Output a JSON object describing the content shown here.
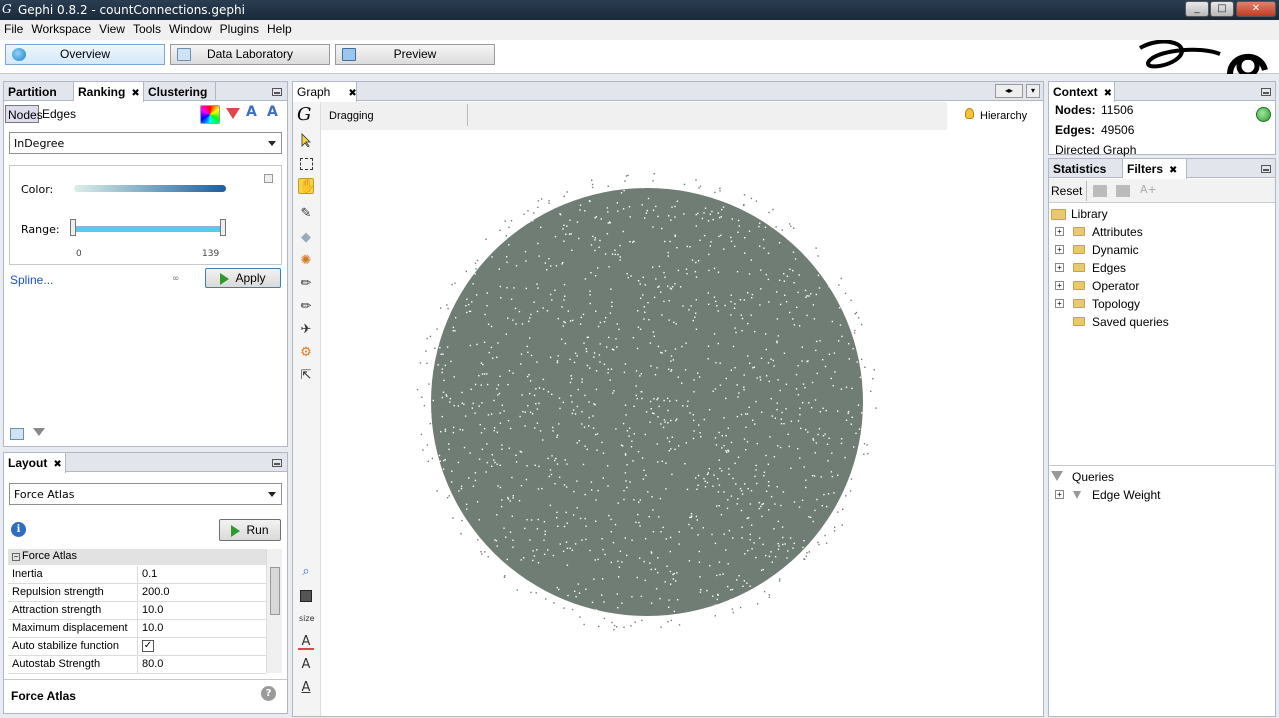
{
  "window": {
    "title": "Gephi 0.8.2 - countConnections.gephi",
    "controls": [
      "_",
      "□",
      "✕"
    ]
  },
  "menu": [
    "File",
    "Workspace",
    "View",
    "Tools",
    "Window",
    "Plugins",
    "Help"
  ],
  "toolbar": {
    "overview": "Overview",
    "data_lab": "Data Laboratory",
    "preview": "Preview"
  },
  "left_top": {
    "tabs": [
      "Partition",
      "Ranking",
      "Clustering"
    ],
    "subtabs": [
      "Nodes",
      "Edges"
    ],
    "ranking_param": "InDegree",
    "color_label": "Color:",
    "range_label": "Range:",
    "range_min": "0",
    "range_max": "139",
    "spline_link": "Spline...",
    "apply_button": "Apply"
  },
  "layout": {
    "title": "Layout",
    "algorithm": "Force Atlas",
    "run_button": "Run",
    "section": "Force Atlas",
    "properties": [
      {
        "name": "Inertia",
        "value": "0.1"
      },
      {
        "name": "Repulsion strength",
        "value": "200.0"
      },
      {
        "name": "Attraction strength",
        "value": "10.0"
      },
      {
        "name": "Maximum displacement",
        "value": "10.0"
      },
      {
        "name": "Auto stabilize function",
        "value": "✓"
      },
      {
        "name": "Autostab Strength",
        "value": "80.0"
      }
    ],
    "footer": "Force Atlas"
  },
  "graph": {
    "tab": "Graph",
    "mode": "Dragging",
    "hierarchy": "Hierarchy",
    "size_label": "size"
  },
  "context": {
    "title": "Context",
    "nodes_label": "Nodes:",
    "nodes": "11506",
    "edges_label": "Edges:",
    "edges": "49506",
    "graph_type": "Directed Graph"
  },
  "filters": {
    "tabs": [
      "Statistics",
      "Filters"
    ],
    "reset": "Reset",
    "library": "Library",
    "items": [
      "Attributes",
      "Dynamic",
      "Edges",
      "Operator",
      "Topology",
      "Saved queries"
    ],
    "queries": "Queries",
    "query_items": [
      "Edge Weight"
    ]
  },
  "colors": {
    "accent": "#3399ff",
    "graph_nodes": "#6f7d74",
    "range_bar": "#55ccee"
  }
}
